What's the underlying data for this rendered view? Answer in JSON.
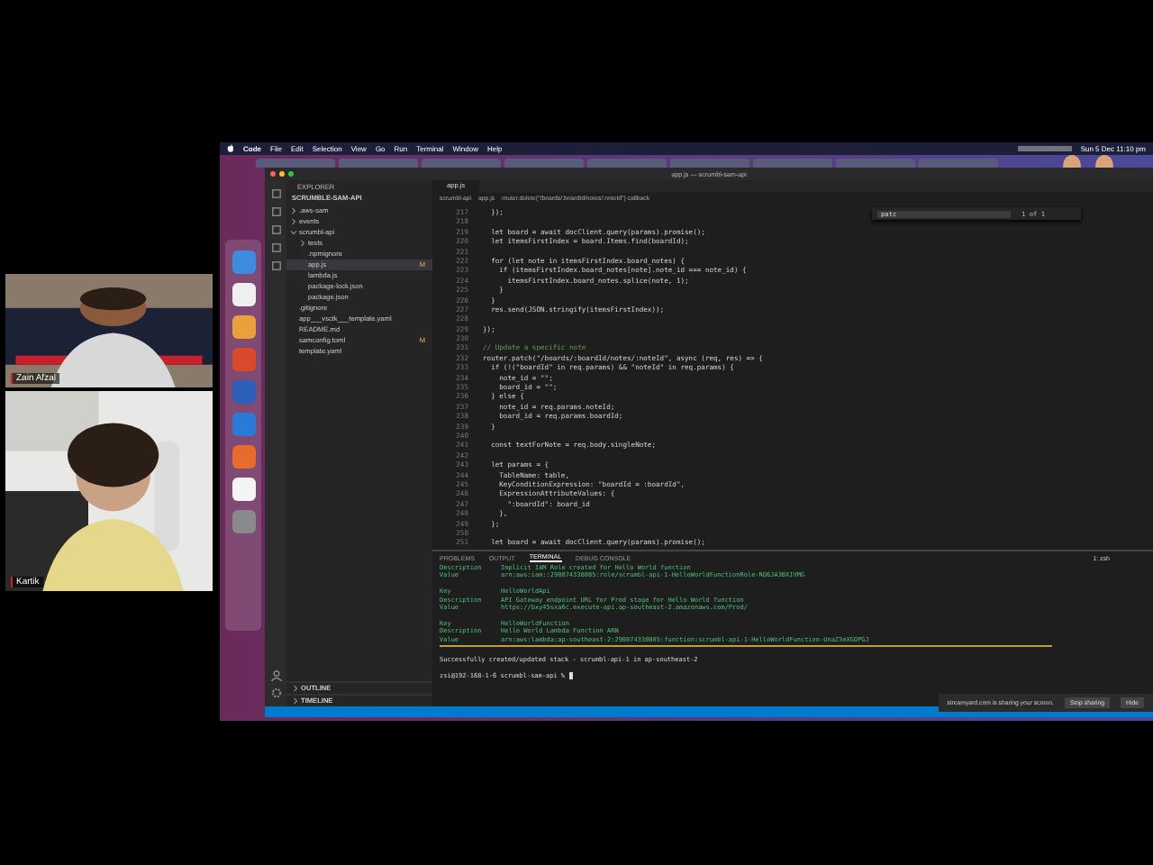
{
  "webcams": [
    {
      "name": "Zain Afzal",
      "kind": "picture"
    },
    {
      "name": "Kartik",
      "kind": "picture"
    }
  ],
  "menu_bar": {
    "app": "Code",
    "items": [
      "File",
      "Edit",
      "Selection",
      "View",
      "Go",
      "Run",
      "Terminal",
      "Window",
      "Help"
    ],
    "clock": "Sun 5 Dec 11:10 pm"
  },
  "window": {
    "title": "app.js — scrumbl-sam-api"
  },
  "sidebar": {
    "title": "EXPLORER",
    "folder": "SCRUMBLE-SAM-API",
    "items": [
      {
        "label": ".aws-sam",
        "kind": "folder",
        "expanded": false,
        "selected": false
      },
      {
        "label": "events",
        "kind": "folder",
        "expanded": false,
        "selected": false
      },
      {
        "label": "scrumbl-api",
        "kind": "folder",
        "expanded": true,
        "selected": false,
        "children": [
          {
            "label": "tests",
            "kind": "folder",
            "expanded": false,
            "selected": false
          },
          {
            "label": ".npmignore",
            "kind": "file",
            "selected": false
          },
          {
            "label": "app.js",
            "kind": "file",
            "selected": true,
            "badge": "M"
          },
          {
            "label": "lambda.js",
            "kind": "file",
            "selected": false
          },
          {
            "label": "package-lock.json",
            "kind": "file",
            "selected": false
          },
          {
            "label": "package.json",
            "kind": "file",
            "selected": false
          }
        ]
      },
      {
        "label": ".gitignore",
        "kind": "file",
        "selected": false
      },
      {
        "label": "app___vsctk___template.yaml",
        "kind": "file",
        "selected": false
      },
      {
        "label": "README.md",
        "kind": "file",
        "selected": false
      },
      {
        "label": "samconfig.toml",
        "kind": "file",
        "selected": false,
        "badge": "M"
      },
      {
        "label": "template.yaml",
        "kind": "file",
        "selected": false
      }
    ],
    "sections": [
      "OUTLINE",
      "TIMELINE"
    ]
  },
  "editor": {
    "tab": "app.js",
    "breadcrumb": [
      "scrumbl-api",
      "app.js",
      "router.delete(\"/boards/:boardId/notes/:noteId\") callback"
    ],
    "find": {
      "query": "patc",
      "result": "1 of 1"
    },
    "lines": [
      {
        "n": "217",
        "text": "  });"
      },
      {
        "n": "218"
      },
      {
        "n": "219",
        "text": "  let board = await docClient.query(params).promise();"
      },
      {
        "n": "220",
        "text": "  let itemsFirstIndex = board.Items.find(boardId);"
      },
      {
        "n": "221"
      },
      {
        "n": "222",
        "text": "  for (let note in itemsFirstIndex.board_notes) {"
      },
      {
        "n": "223",
        "text": "    if (itemsFirstIndex.board_notes[note].note_id === note_id) {"
      },
      {
        "n": "224",
        "text": "      itemsFirstIndex.board_notes.splice(note, 1);"
      },
      {
        "n": "225",
        "text": "    }"
      },
      {
        "n": "226",
        "text": "  }"
      },
      {
        "n": "227",
        "text": "  res.send(JSON.stringify(itemsFirstIndex));"
      },
      {
        "n": "228"
      },
      {
        "n": "229",
        "text": "});"
      },
      {
        "n": "230"
      },
      {
        "n": "231",
        "text": "// Update a specific note",
        "kind": "comment"
      },
      {
        "n": "232",
        "text": "router.patch(\"/boards/:boardId/notes/:noteId\", async (req, res) => {"
      },
      {
        "n": "233",
        "text": "  if (!(\"boardId\" in req.params) && \"noteId\" in req.params) {"
      },
      {
        "n": "234",
        "text": "    note_id = \"\";"
      },
      {
        "n": "235",
        "text": "    board_id = \"\";"
      },
      {
        "n": "236",
        "text": "  } else {"
      },
      {
        "n": "237",
        "text": "    note_id = req.params.noteId;"
      },
      {
        "n": "238",
        "text": "    board_id = req.params.boardId;"
      },
      {
        "n": "239",
        "text": "  }"
      },
      {
        "n": "240"
      },
      {
        "n": "241",
        "text": "  const textForNote = req.body.singleNote;"
      },
      {
        "n": "242"
      },
      {
        "n": "243",
        "text": "  let params = {"
      },
      {
        "n": "244",
        "text": "    TableName: table,"
      },
      {
        "n": "245",
        "text": "    KeyConditionExpression: \"boardId = :boardId\","
      },
      {
        "n": "246",
        "text": "    ExpressionAttributeValues: {"
      },
      {
        "n": "247",
        "text": "      \":boardId\": board_id"
      },
      {
        "n": "248",
        "text": "    },"
      },
      {
        "n": "249",
        "text": "  };"
      },
      {
        "n": "250"
      },
      {
        "n": "251",
        "text": "  let board = await docClient.query(params).promise();"
      }
    ]
  },
  "panel": {
    "tabs": [
      {
        "label": "PROBLEMS",
        "selected": false
      },
      {
        "label": "OUTPUT",
        "selected": false
      },
      {
        "label": "TERMINAL",
        "selected": true
      },
      {
        "label": "DEBUG CONSOLE",
        "selected": false
      }
    ],
    "shell": "1: zsh",
    "lines": [
      {
        "kind": "output",
        "key": "Description",
        "value": "Implicit IAM Role created for Hello World function"
      },
      {
        "kind": "output",
        "key": "Value",
        "value": "arn:aws:iam::290874338085:role/scrumbl-api-1-HelloWorldFunctionRole-RO6JA3BXIVMG"
      },
      {
        "kind": "blank"
      },
      {
        "kind": "output",
        "key": "Key",
        "value": "HelloWorldApi"
      },
      {
        "kind": "output",
        "key": "Description",
        "value": "API Gateway endpoint URL for Prod stage for Hello World function"
      },
      {
        "kind": "output",
        "key": "Value",
        "value": "https://bxy45sxa6c.execute-api.ap-southeast-2.amazonaws.com/Prod/"
      },
      {
        "kind": "blank"
      },
      {
        "kind": "output",
        "key": "Key",
        "value": "HelloWorldFunction"
      },
      {
        "kind": "output",
        "key": "Description",
        "value": "Hello World Lambda Function ARN"
      },
      {
        "kind": "output",
        "key": "Value",
        "value": "arn:aws:lambda:ap-southeast-2:290874338085:function:scrumbl-api-1-HelloWorldFunction-UnaZ3eXGOPGJ"
      },
      {
        "kind": "rule"
      },
      {
        "kind": "blank"
      },
      {
        "kind": "plain",
        "text": "Successfully created/updated stack - scrumbl-api-1 in ap-southeast-2"
      },
      {
        "kind": "blank"
      },
      {
        "kind": "prompt",
        "text": "zsi@192-168-1-6 scrumbl-sam-api % "
      }
    ]
  },
  "share_notice": {
    "text": "streamyard.com is sharing your screen.",
    "stop": "Stop sharing",
    "hide": "Hide"
  }
}
